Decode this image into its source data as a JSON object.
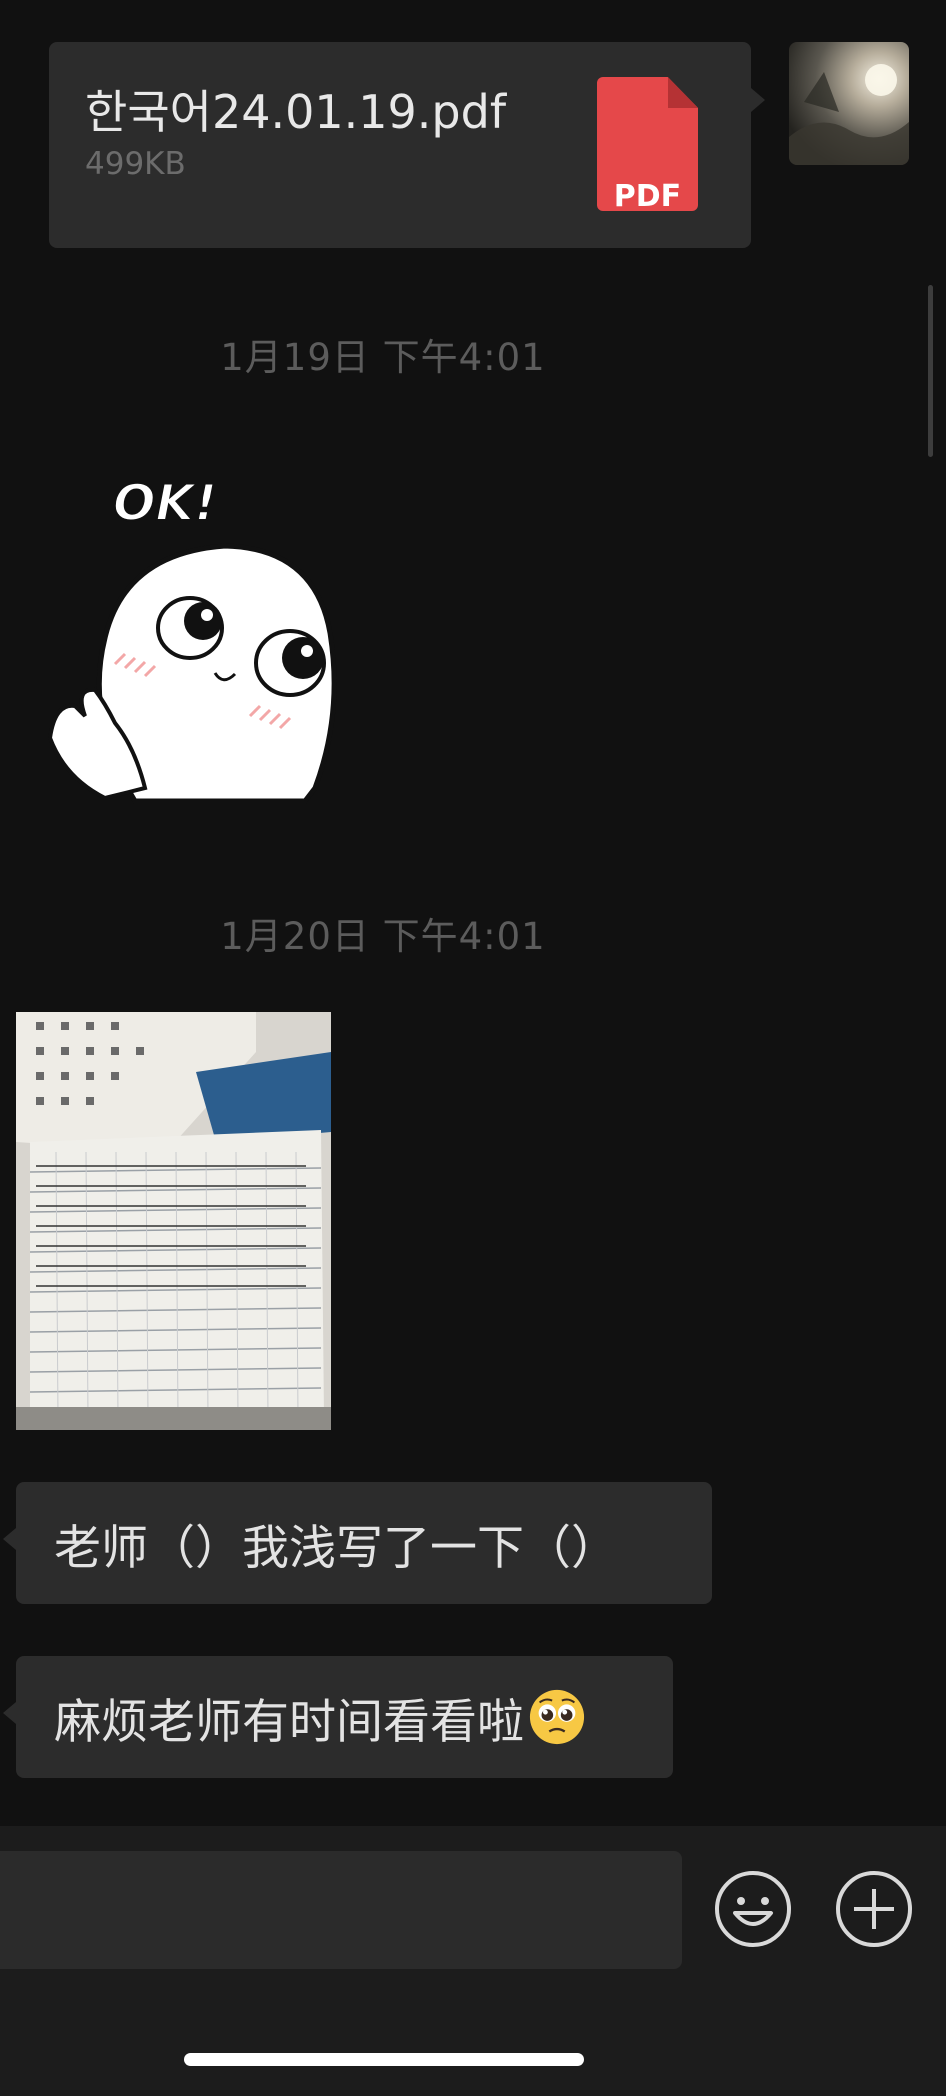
{
  "file_message": {
    "file_name": "한국어24.01.19.pdf",
    "file_size": "499KB",
    "file_type_label": "PDF"
  },
  "timestamps": [
    "1月19日 下午4:01",
    "1月20日 下午4:01"
  ],
  "sticker": {
    "text": "OK!"
  },
  "messages": [
    {
      "text": "老师（）我浅写了一下（）"
    },
    {
      "text": "麻烦老师有时间看看啦",
      "emoji": "pleading-face"
    }
  ],
  "input_bar": {
    "message_input_value": "",
    "buttons": [
      "emoji",
      "plus"
    ]
  },
  "colors": {
    "background": "#111111",
    "bubble": "#2c2c2c",
    "pdf_red": "#e5484a",
    "timestamp": "#5c5c5c",
    "input_bar": "#1c1c1c"
  }
}
